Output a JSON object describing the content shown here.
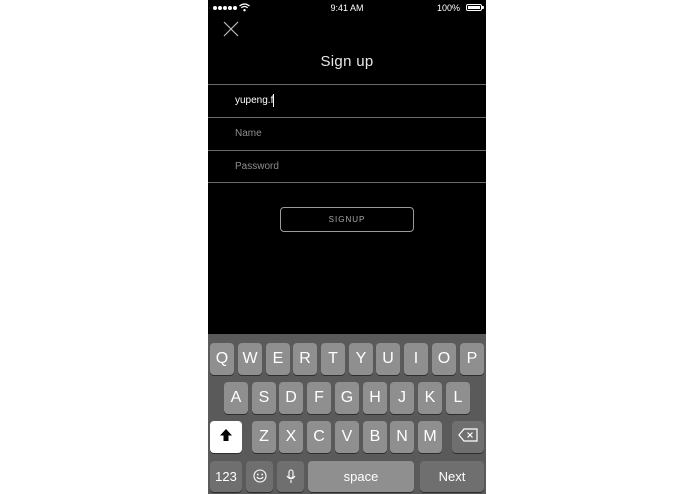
{
  "status_bar": {
    "time": "9:41 AM",
    "battery": "100%",
    "signal_icon": "signal-dots-icon",
    "wifi_icon": "wifi-icon",
    "battery_icon": "battery-icon"
  },
  "header": {
    "close_icon": "close-icon",
    "title": "Sign up"
  },
  "form": {
    "email_value": "yupeng.f",
    "name_placeholder": "Name",
    "password_placeholder": "Password",
    "signup_label": "SIGNUP"
  },
  "keyboard": {
    "row1": [
      "Q",
      "W",
      "E",
      "R",
      "T",
      "Y",
      "U",
      "I",
      "O",
      "P"
    ],
    "row2": [
      "A",
      "S",
      "D",
      "F",
      "G",
      "H",
      "J",
      "K",
      "L"
    ],
    "row3": [
      "Z",
      "X",
      "C",
      "V",
      "B",
      "N",
      "M"
    ],
    "numbers_label": "123",
    "space_label": "space",
    "next_label": "Next",
    "shift_icon": "shift-icon",
    "backspace_icon": "backspace-icon",
    "emoji_icon": "emoji-icon",
    "mic_icon": "microphone-icon"
  },
  "colors": {
    "screen_background": "#000000",
    "keyboard_background": "#5a5a5a",
    "key_background": "#8f8f8f",
    "key_dark_background": "#6f6f6f"
  }
}
